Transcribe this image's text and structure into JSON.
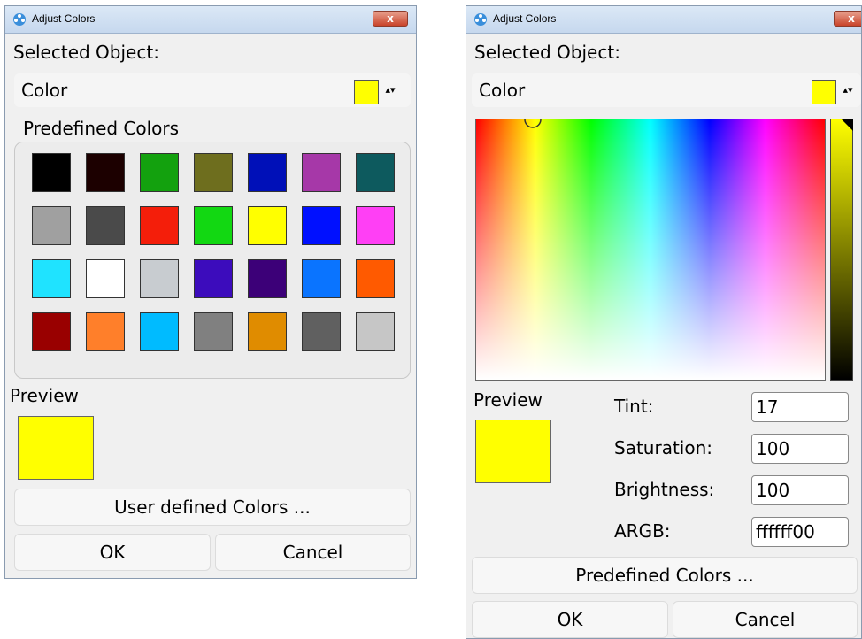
{
  "left_window": {
    "title": "Adjust Colors",
    "close_label": "x",
    "selected_object_label": "Selected Object:",
    "dropdown_value": "Color",
    "dropdown_arrow": "▴▾",
    "predefined_label": "Predefined Colors",
    "preview_label": "Preview",
    "preview_color": "#ffff00",
    "user_defined_button": "User defined Colors ...",
    "ok_button": "OK",
    "cancel_button": "Cancel",
    "swatches": [
      "#000000",
      "#1c0000",
      "#13a10e",
      "#6e6e1e",
      "#0010b8",
      "#a638a8",
      "#0d5a5e",
      "#a0a0a0",
      "#4a4a4a",
      "#f41e0a",
      "#12d812",
      "#ffff00",
      "#0010ff",
      "#ff3ff5",
      "#1fe3ff",
      "#ffffff",
      "#c8ccd0",
      "#3c0cbc",
      "#3c0078",
      "#0a74ff",
      "#ff5a00",
      "#990000",
      "#ff7f2a",
      "#00bbff",
      "#808080",
      "#e08c00",
      "#606060",
      "#c6c6c6"
    ]
  },
  "right_window": {
    "title": "Adjust Colors",
    "close_label": "x",
    "selected_object_label": "Selected Object:",
    "dropdown_value": "Color",
    "dropdown_arrow": "▴▾",
    "preview_label": "Preview",
    "preview_color": "#ffff00",
    "fields": [
      {
        "label": "Tint:",
        "value": "17"
      },
      {
        "label": "Saturation:",
        "value": "100"
      },
      {
        "label": "Brightness:",
        "value": "100"
      },
      {
        "label": "ARGB:",
        "value": "ffffff00"
      }
    ],
    "predefined_button": "Predefined Colors ...",
    "ok_button": "OK",
    "cancel_button": "Cancel"
  }
}
